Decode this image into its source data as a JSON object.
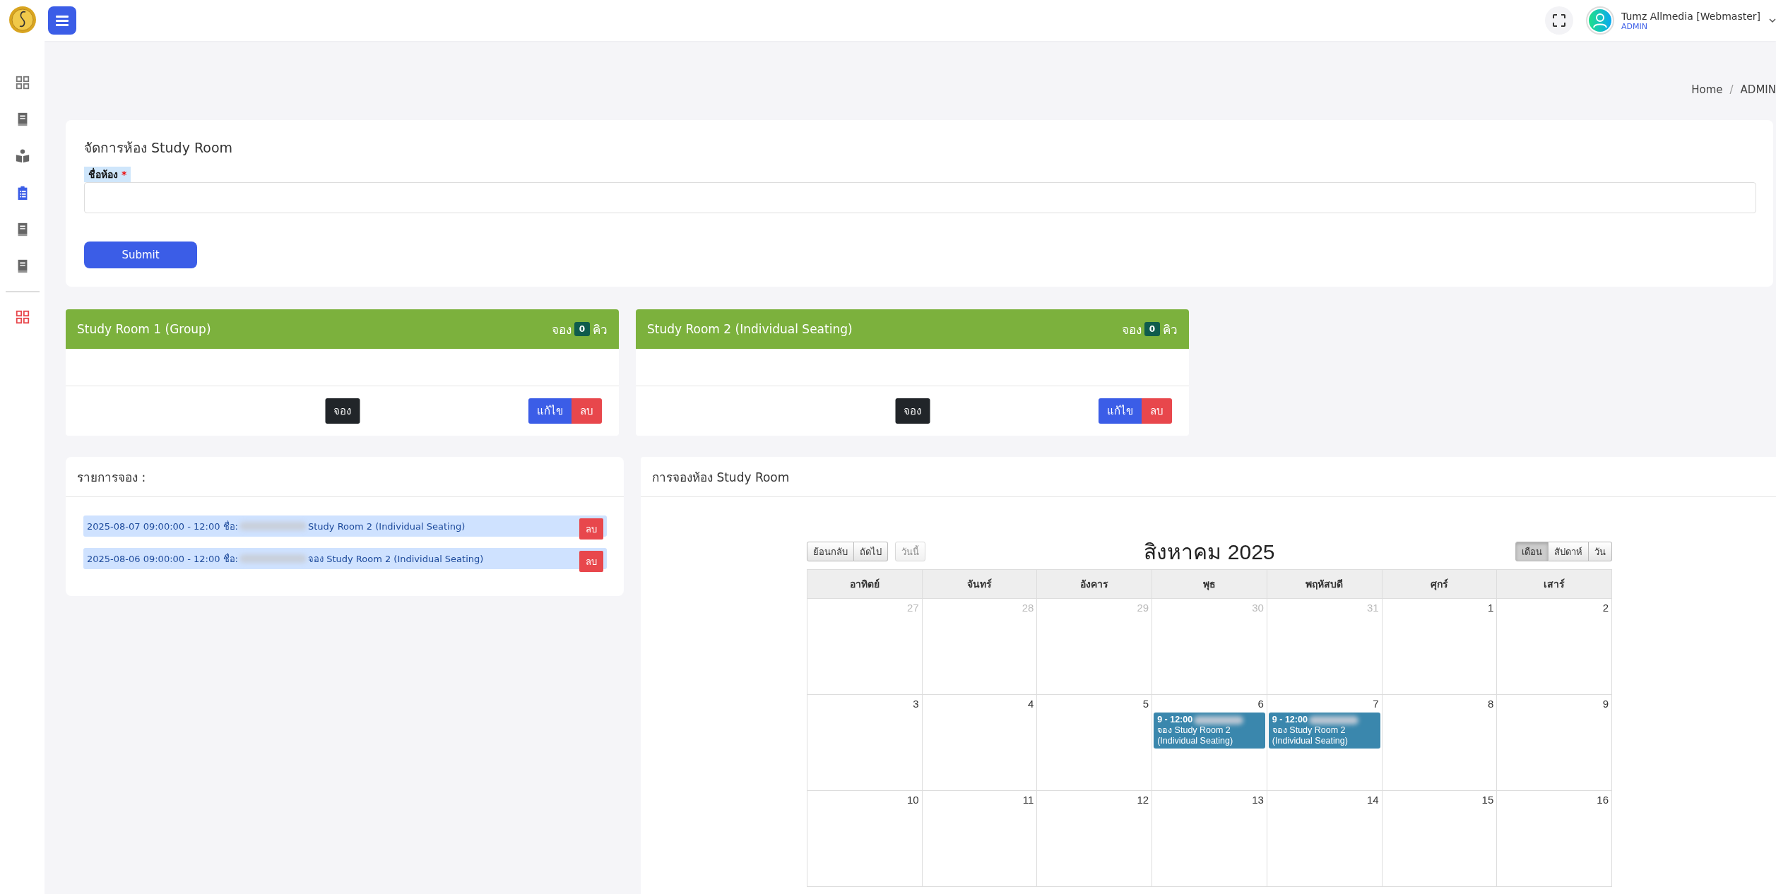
{
  "sidebar": {
    "items": [
      {
        "kind": "grid",
        "selected": false
      },
      {
        "kind": "book",
        "selected": false
      },
      {
        "kind": "reader",
        "selected": false
      },
      {
        "kind": "clipboard",
        "selected": true
      },
      {
        "kind": "book",
        "selected": false
      },
      {
        "kind": "book",
        "selected": false
      },
      {
        "kind": "apps",
        "selected": false
      }
    ]
  },
  "topbar": {
    "user_name": "Tumz Allmedia [Webmaster]",
    "user_role": "ADMIN"
  },
  "breadcrumb": {
    "items": [
      "Home",
      "ADMIN"
    ],
    "separator": "/"
  },
  "form": {
    "title": "จัดการห้อง Study Room",
    "label": "ชื่อห้อง",
    "required_mark": "*",
    "submit": "Submit"
  },
  "rooms": [
    {
      "name": "Study Room 1 (Group)",
      "queue_prefix": "จอง",
      "count": "0",
      "queue_suffix": "คิว",
      "book_button": "จอง",
      "edit_button": "แก้ไข",
      "delete_button": "ลบ"
    },
    {
      "name": "Study Room 2 (Individual Seating)",
      "queue_prefix": "จอง",
      "count": "0",
      "queue_suffix": "คิว",
      "book_button": "จอง",
      "edit_button": "แก้ไข",
      "delete_button": "ลบ"
    }
  ],
  "bookings": {
    "title": "รายการจอง :",
    "items": [
      {
        "text_before": "2025-08-07 09:00:00 - 12:00 ชื่อ:",
        "text_after": "Study Room 2 (Individual Seating)",
        "delete_button": "ลบ"
      },
      {
        "text_before": "2025-08-06 09:00:00 - 12:00 ชื่อ:",
        "text_after": "จอง Study Room 2 (Individual Seating)",
        "delete_button": "ลบ"
      }
    ]
  },
  "calendar": {
    "title": "การจองห้อง Study Room",
    "nav": [
      "ย้อนกลับ",
      "ถัดไป"
    ],
    "today": {
      "label": "วันนี้",
      "disabled": true
    },
    "month": "สิงหาคม 2025",
    "views": [
      {
        "label": "เดือน",
        "selected": true
      },
      {
        "label": "สัปดาห์",
        "selected": false
      },
      {
        "label": "วัน",
        "selected": false
      }
    ],
    "weekdays": [
      "อาทิตย์",
      "จันทร์",
      "อังคาร",
      "พุธ",
      "พฤหัสบดี",
      "ศุกร์",
      "เสาร์"
    ],
    "weeks": [
      [
        {
          "day": "27",
          "other_month": true
        },
        {
          "day": "28",
          "other_month": true
        },
        {
          "day": "29",
          "other_month": true
        },
        {
          "day": "30",
          "other_month": true
        },
        {
          "day": "31",
          "other_month": true
        },
        {
          "day": "1",
          "other_month": false
        },
        {
          "day": "2",
          "other_month": false
        }
      ],
      [
        {
          "day": "3",
          "other_month": false
        },
        {
          "day": "4",
          "other_month": false
        },
        {
          "day": "5",
          "other_month": false
        },
        {
          "day": "6",
          "other_month": false,
          "events": [
            {
              "time": "9  - 12:00",
              "text": "จอง Study Room 2 (Individual Seating)"
            }
          ]
        },
        {
          "day": "7",
          "other_month": false,
          "events": [
            {
              "time": "9  - 12:00",
              "text": "จอง Study Room 2 (Individual Seating)"
            }
          ]
        },
        {
          "day": "8",
          "other_month": false
        },
        {
          "day": "9",
          "other_month": false
        }
      ],
      [
        {
          "day": "10",
          "other_month": false
        },
        {
          "day": "11",
          "other_month": false
        },
        {
          "day": "12",
          "other_month": false
        },
        {
          "day": "13",
          "other_month": false
        },
        {
          "day": "14",
          "other_month": false
        },
        {
          "day": "15",
          "other_month": false
        },
        {
          "day": "16",
          "other_month": false
        }
      ]
    ]
  }
}
